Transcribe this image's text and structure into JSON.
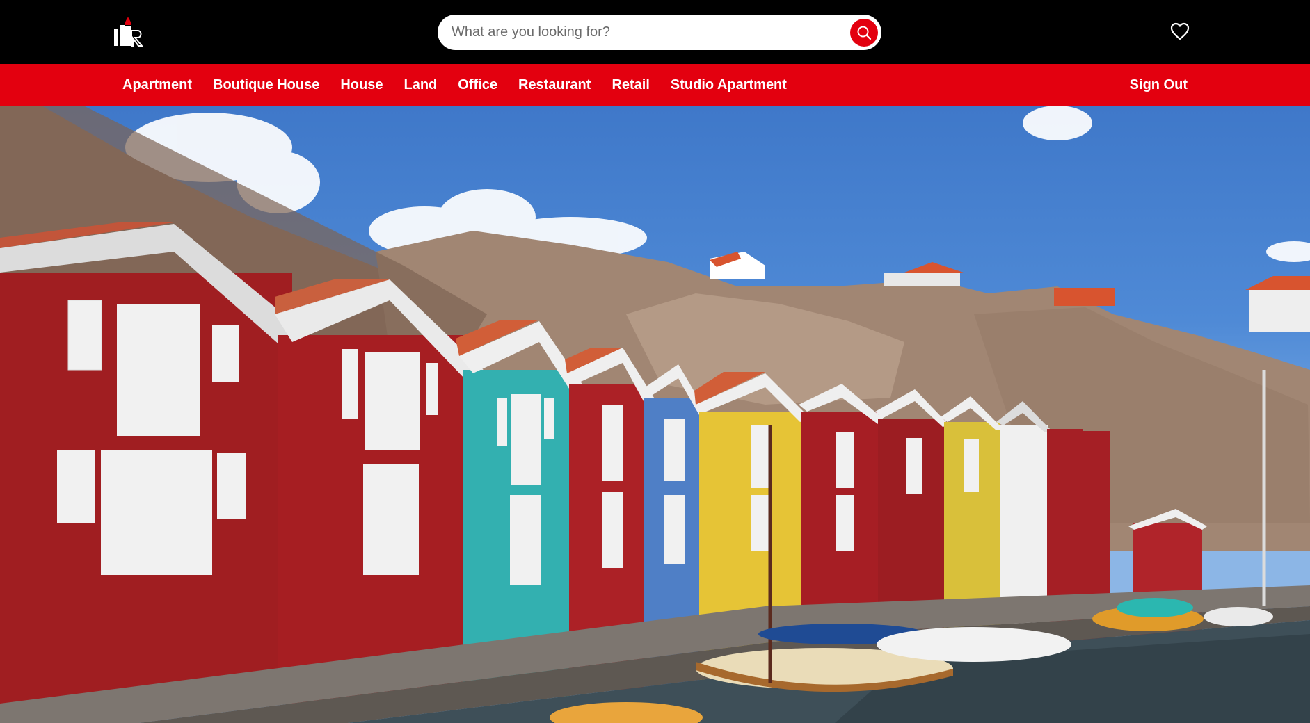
{
  "header": {
    "logo_icon": "building-logo-icon",
    "search": {
      "placeholder": "What are you looking for?",
      "value": "",
      "button_icon": "search-icon"
    },
    "favorites_icon": "heart-icon"
  },
  "nav": {
    "items": [
      {
        "label": "Apartment"
      },
      {
        "label": "Boutique House"
      },
      {
        "label": "House"
      },
      {
        "label": "Land"
      },
      {
        "label": "Office"
      },
      {
        "label": "Restaurant"
      },
      {
        "label": "Retail"
      },
      {
        "label": "Studio Apartment"
      }
    ],
    "sign_out": "Sign Out"
  },
  "hero": {
    "scene": "hero-image"
  },
  "colors": {
    "brand_red": "#e3000f",
    "header_bg": "#000000"
  }
}
